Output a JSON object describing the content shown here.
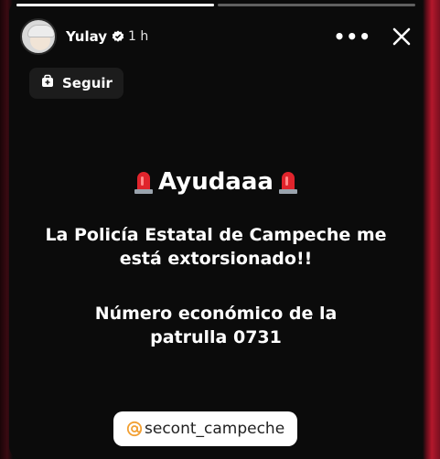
{
  "story": {
    "progress": [
      1.0,
      0.0
    ],
    "user": {
      "name": "Yulay",
      "time": "1 h",
      "avatar_icon": "avatar",
      "verified_icon": "verified-badge-icon"
    },
    "actions": {
      "more_label": "•••",
      "close_icon": "close-icon"
    },
    "follow_button": {
      "label": "Seguir",
      "icon": "follow-icon"
    },
    "content": {
      "title": "Ayudaaa",
      "siren_icon": "siren-emoji-icon",
      "line1": "La Policía Estatal de Campeche me",
      "line2": "está extorsionado!!",
      "line3": "Número económico de la",
      "line4": "patrulla 0731"
    },
    "mention": {
      "handle": "secont_campeche",
      "icon": "mention-at-icon"
    }
  },
  "colors": {
    "story_bg": "#0b0b0b",
    "accent_red": "#e0242c",
    "mention_orange": "#f2a033",
    "text": "#ffffff"
  }
}
